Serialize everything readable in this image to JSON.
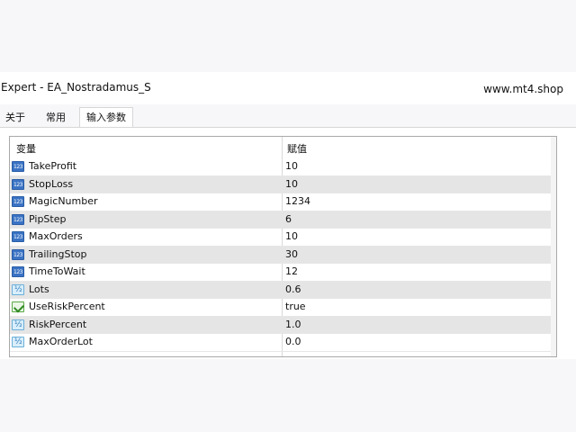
{
  "window": {
    "title": "Expert - EA_Nostradamus_S",
    "site": "www.mt4.shop"
  },
  "tabs": [
    {
      "label": "关于",
      "active": false
    },
    {
      "label": "常用",
      "active": false
    },
    {
      "label": "输入参数",
      "active": true
    }
  ],
  "table": {
    "headers": {
      "variable": "变量",
      "value": "赋值"
    },
    "rows": [
      {
        "icon": "integer-icon",
        "name": "TakeProfit",
        "value": "10"
      },
      {
        "icon": "integer-icon",
        "name": "StopLoss",
        "value": "10"
      },
      {
        "icon": "integer-icon",
        "name": "MagicNumber",
        "value": "1234"
      },
      {
        "icon": "integer-icon",
        "name": "PipStep",
        "value": "6"
      },
      {
        "icon": "integer-icon",
        "name": "MaxOrders",
        "value": "10"
      },
      {
        "icon": "integer-icon",
        "name": "TrailingStop",
        "value": "30"
      },
      {
        "icon": "integer-icon",
        "name": "TimeToWait",
        "value": "12"
      },
      {
        "icon": "double-icon",
        "name": "Lots",
        "value": "0.6"
      },
      {
        "icon": "bool-icon",
        "name": "UseRiskPercent",
        "value": "true"
      },
      {
        "icon": "double-icon",
        "name": "RiskPercent",
        "value": "1.0"
      },
      {
        "icon": "double-icon",
        "name": "MaxOrderLot",
        "value": "0.0"
      }
    ]
  }
}
